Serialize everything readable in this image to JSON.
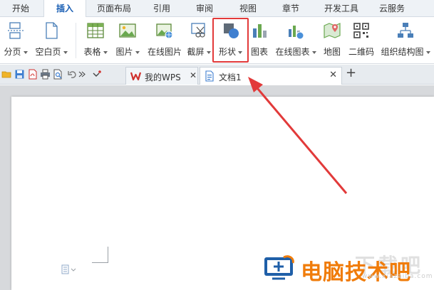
{
  "menu": {
    "tabs": [
      {
        "label": "开始",
        "active": false
      },
      {
        "label": "插入",
        "active": true
      },
      {
        "label": "页面布局",
        "active": false
      },
      {
        "label": "引用",
        "active": false
      },
      {
        "label": "审阅",
        "active": false
      },
      {
        "label": "视图",
        "active": false
      },
      {
        "label": "章节",
        "active": false
      },
      {
        "label": "开发工具",
        "active": false
      },
      {
        "label": "云服务",
        "active": false
      }
    ]
  },
  "ribbon": {
    "buttons": [
      {
        "label": "分页",
        "icon": "page-break-icon",
        "dropdown": true
      },
      {
        "label": "空白页",
        "icon": "blank-page-icon",
        "dropdown": true
      },
      {
        "label": "表格",
        "icon": "table-icon",
        "dropdown": true
      },
      {
        "label": "图片",
        "icon": "picture-icon",
        "dropdown": true
      },
      {
        "label": "在线图片",
        "icon": "online-picture-icon",
        "dropdown": false
      },
      {
        "label": "截屏",
        "icon": "screenshot-icon",
        "dropdown": true
      },
      {
        "label": "形状",
        "icon": "shapes-icon",
        "dropdown": true
      },
      {
        "label": "图表",
        "icon": "chart-icon",
        "dropdown": false
      },
      {
        "label": "在线图表",
        "icon": "online-chart-icon",
        "dropdown": true
      },
      {
        "label": "地图",
        "icon": "map-icon",
        "dropdown": false
      },
      {
        "label": "二维码",
        "icon": "qr-code-icon",
        "dropdown": false
      },
      {
        "label": "组织结构图",
        "icon": "org-chart-icon",
        "dropdown": true
      }
    ]
  },
  "doc_tabs": [
    {
      "title": "我的WPS",
      "icon": "wps-logo-icon",
      "active": false
    },
    {
      "title": "文档1",
      "icon": "document-icon",
      "active": true
    }
  ],
  "colors": {
    "highlight": "#e23a3a",
    "accent": "#1a5fb4",
    "watermark": "#f07c0a"
  },
  "watermark": {
    "text": "电脑技术吧",
    "ghost": "下载吧",
    "url": "www.xiazaiba.com"
  }
}
